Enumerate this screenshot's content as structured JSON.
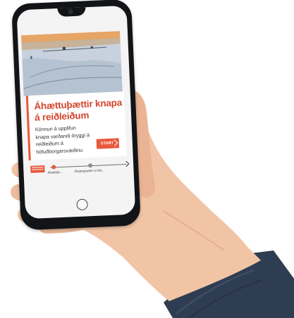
{
  "screen": {
    "title": "Áhættuþættir knapa á reiðleiðum",
    "description": "Könnun á upplifun knapa varðandi öryggi á reiðleiðum á höfuðborgarsvæðinu",
    "start_button": {
      "label": "START",
      "icon": "chevron-right-icon"
    }
  },
  "progress_nav": {
    "steps": [
      {
        "label": "Áhættuþ…",
        "active": true
      },
      {
        "label": "Áhættuþættir á bílu…",
        "active": false
      }
    ],
    "next_icon": "chevron-right-icon"
  },
  "colors": {
    "accent": "#e8573a",
    "title": "#d2452c",
    "phone_body": "#121417",
    "skin": "#f1c4a6",
    "sleeve": "#2f3d52"
  },
  "hero_image": {
    "description_icon": "snowy-landscape-photo"
  }
}
